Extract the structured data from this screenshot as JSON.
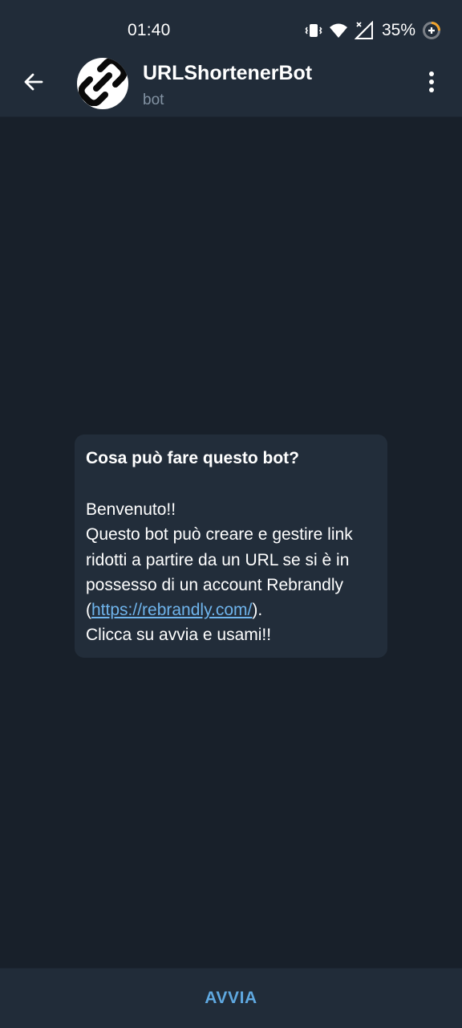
{
  "status_bar": {
    "time": "01:40",
    "battery_percent": "35%",
    "icons": [
      "vibrate-icon",
      "wifi-icon",
      "no-signal-icon",
      "battery-saver-icon"
    ]
  },
  "header": {
    "title": "URLShortenerBot",
    "subtitle": "bot",
    "icons": [
      "back-arrow-icon",
      "link-logo-icon",
      "more-vert-icon"
    ]
  },
  "info_card": {
    "title": "Cosa può fare questo bot?",
    "line1": "Benvenuto!!",
    "line2": "Questo bot può creare e gestire link ridotti a partire da un URL se si è in possesso di un account Rebrandly",
    "paren_open": "(",
    "link": "https://rebrandly.com/",
    "paren_close": ").",
    "line3": "Clicca su avvia e usami!!"
  },
  "bottom_bar": {
    "start_label": "AVVIA"
  },
  "colors": {
    "background": "#18202a",
    "bar": "#212c39",
    "card": "#222d3a",
    "link": "#6fb4ec",
    "accent": "#5fa8e0",
    "subtitle": "#8393a3"
  }
}
